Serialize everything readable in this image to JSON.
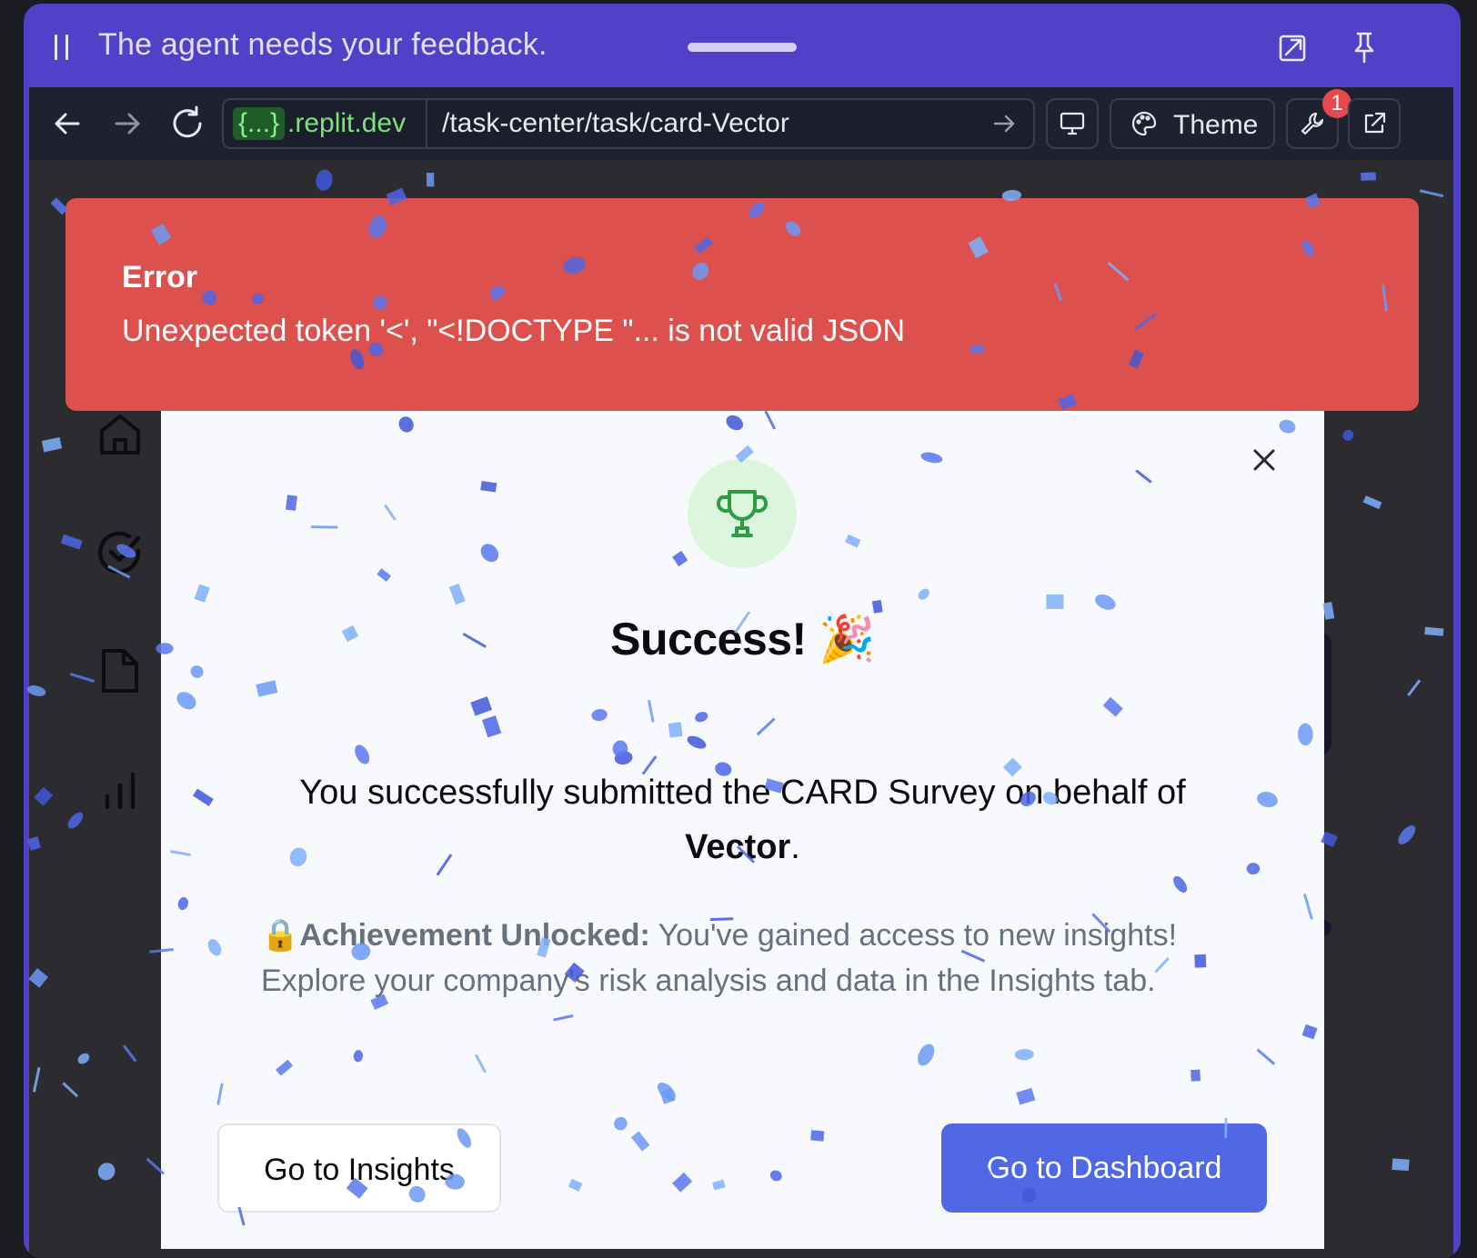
{
  "titlebar": {
    "title": "The agent needs your feedback."
  },
  "browser": {
    "url_badge": "{...}",
    "url_domain": ".replit.dev",
    "url_path": "/task-center/task/card-Vector",
    "theme_label": "Theme",
    "notification_count": "1"
  },
  "background": {
    "percent_symbol": "%"
  },
  "error": {
    "title": "Error",
    "message": "Unexpected token '<', \"<!DOCTYPE \"... is not valid JSON"
  },
  "modal": {
    "title": "Success! 🎉",
    "message_prefix": "You successfully submitted the CARD Survey on behalf of ",
    "company": "Vector",
    "message_suffix": ".",
    "achievement_icon": "🔒",
    "achievement_label": "Achievement Unlocked:",
    "achievement_text": " You've gained access to new insights! Explore your company's risk analysis and data in the Insights tab.",
    "insights_button": "Go to Insights",
    "dashboard_button": "Go to Dashboard"
  },
  "colors": {
    "frame_accent": "#5340c9",
    "error_bg": "#dc514e",
    "primary_button": "#5068e4",
    "trophy_green": "#2f9a46",
    "url_green": "#7ee07e"
  },
  "icons": [
    "pause-icon",
    "pop-out-icon",
    "pin-icon",
    "back-arrow-icon",
    "forward-arrow-icon",
    "reload-icon",
    "go-arrow-icon",
    "monitor-icon",
    "palette-icon",
    "wrench-icon",
    "external-link-icon",
    "home-icon",
    "check-circle-icon",
    "file-icon",
    "bar-chart-icon",
    "trophy-icon",
    "close-icon"
  ]
}
